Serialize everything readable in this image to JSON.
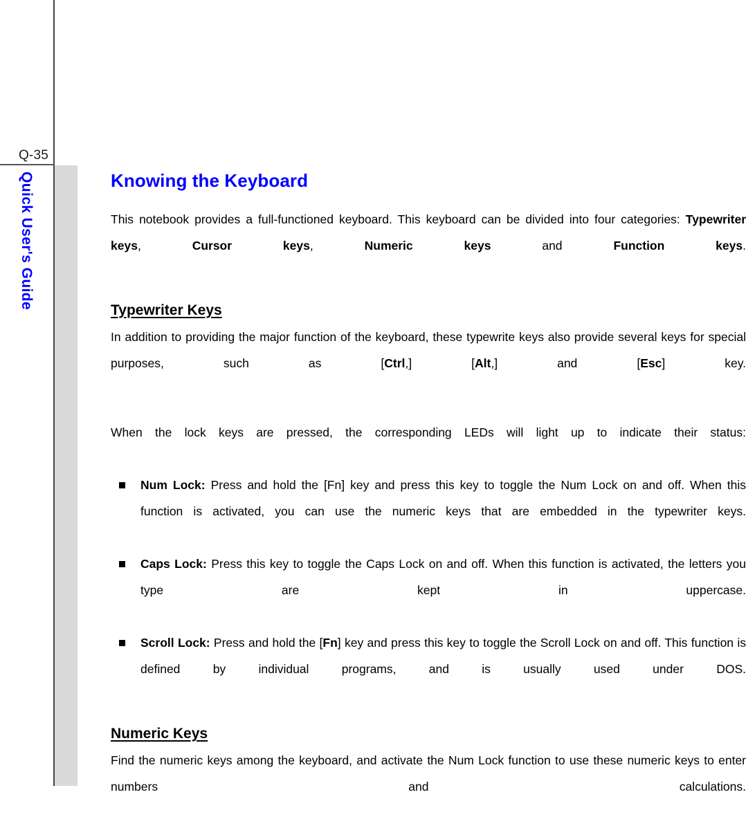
{
  "page": {
    "number_label": "Q-35",
    "side_title": "Quick User's Guide",
    "accent_color": "#0000FF",
    "rule_color": "#444444",
    "band_color": "#D9D9D9"
  },
  "content": {
    "title": "Knowing the Keyboard",
    "intro": {
      "lead": "This notebook provides a full-functioned keyboard.  This keyboard can be divided into four categories: ",
      "cat1": "Typewriter keys",
      "sep1": ", ",
      "cat2": "Cursor keys",
      "sep2": ", ",
      "cat3": "Numeric keys",
      "sep3": " and ",
      "cat4": "Function keys",
      "end": "."
    },
    "sections": [
      {
        "heading": "Typewriter Keys",
        "para_a_1": "In addition to providing the major function of the keyboard, these typewrite keys also provide several keys for special purposes, such as [",
        "key_ctrl": "Ctrl",
        "para_a_2": ",] [",
        "key_alt": "Alt",
        "para_a_3": ",] and [",
        "key_esc": "Esc",
        "para_a_4": "] key.",
        "para_b": "When the lock keys are pressed, the corresponding LEDs will light up to indicate their status:",
        "bullets": [
          {
            "term": "Num Lock:",
            "text": " Press and hold the [Fn] key and press this key to toggle the Num Lock on and off.  When this function is activated, you can use the numeric keys that are embedded in the typewriter keys."
          },
          {
            "term": "Caps Lock:",
            "text": " Press this key to toggle the Caps Lock on and off.   When this function is activated, the letters you type are kept in uppercase."
          },
          {
            "term": "Scroll Lock:",
            "text_1": " Press and hold the [",
            "key_fn": "Fn",
            "text_2": "] key and press this key to toggle the Scroll Lock on and off. This function is defined by individual programs, and is usually used under DOS."
          }
        ]
      },
      {
        "heading": "Numeric Keys",
        "para": "Find the numeric keys among the keyboard, and activate the Num Lock function to use these numeric keys to enter numbers and calculations."
      }
    ]
  }
}
